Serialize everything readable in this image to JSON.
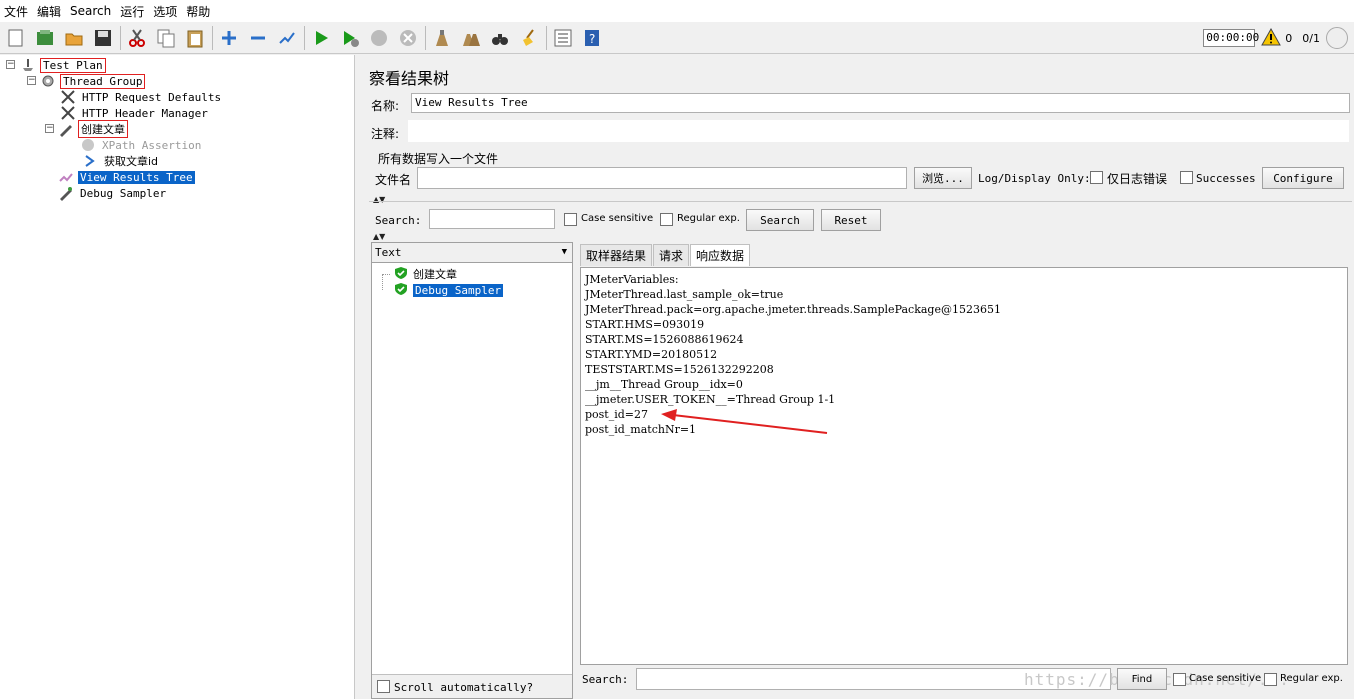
{
  "menu": [
    "文件",
    "编辑",
    "Search",
    "运行",
    "选项",
    "帮助"
  ],
  "toolbar": {
    "timer": "00:00:00",
    "warn_count": "0",
    "threads": "0/1"
  },
  "tree": {
    "test_plan": "Test Plan",
    "thread_group": "Thread Group",
    "http_defaults": "HTTP Request Defaults",
    "http_header": "HTTP Header Manager",
    "create_article": "创建文章",
    "xpath_assertion": "XPath Assertion",
    "get_article_id": "获取文章id",
    "view_results_tree": "View Results Tree",
    "debug_sampler": "Debug Sampler"
  },
  "panel": {
    "title": "察看结果树",
    "name_label": "名称:",
    "name_value": "View Results Tree",
    "comment_label": "注释:",
    "group_title": "所有数据写入一个文件",
    "file_label": "文件名",
    "browse_button": "浏览...",
    "log_display": "Log/Display Only:",
    "errors_only": "仅日志错误",
    "successes": "Successes",
    "configure_button": "Configure",
    "search_label": "Search:",
    "case_sensitive": "Case sensitive",
    "regex": "Regular exp.",
    "search_button": "Search",
    "reset_button": "Reset"
  },
  "results": {
    "renderer": "Text",
    "items": [
      "创建文章",
      "Debug Sampler"
    ],
    "scroll_auto": "Scroll automatically?"
  },
  "tabs": [
    "取样器结果",
    "请求",
    "响应数据"
  ],
  "response_lines": [
    "JMeterVariables:",
    "JMeterThread.last_sample_ok=true",
    "JMeterThread.pack=org.apache.jmeter.threads.SamplePackage@1523651",
    "START.HMS=093019",
    "START.MS=1526088619624",
    "START.YMD=20180512",
    "TESTSTART.MS=1526132292208",
    "__jm__Thread Group__idx=0",
    "__jmeter.USER_TOKEN__=Thread Group 1-1",
    "post_id=27",
    "post_id_matchNr=1"
  ],
  "footer": {
    "search_label": "Search:",
    "find_button": "Find",
    "case_sensitive": "Case sensitive",
    "regex": "Regular exp.",
    "watermark": "https://blog.csdn.net/..."
  },
  "colors": {
    "selection": "#0a64c8",
    "highlight_box": "#e02020",
    "arrow": "#e02020"
  }
}
